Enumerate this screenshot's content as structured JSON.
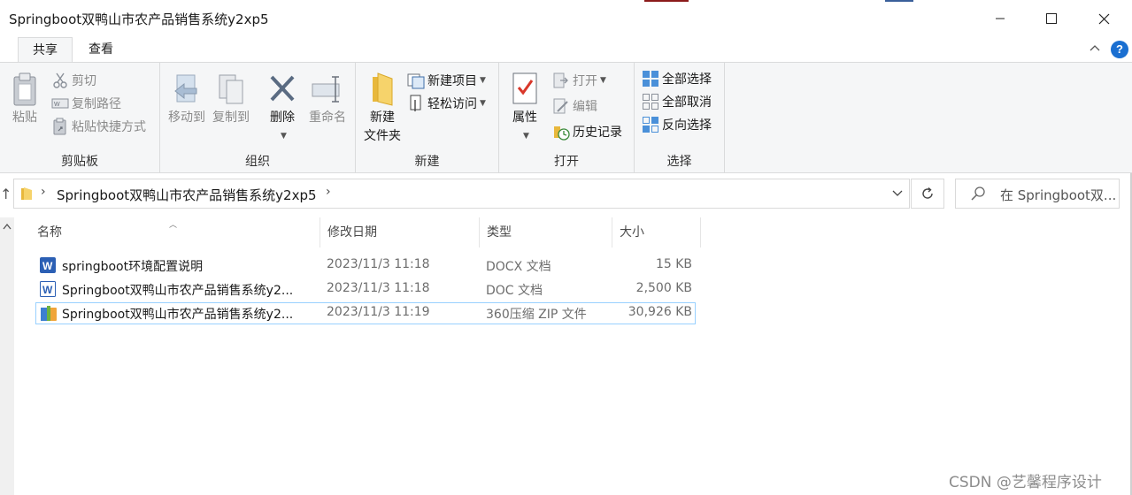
{
  "window": {
    "title": "Springboot双鸭山市农产品销售系统y2xp5"
  },
  "tabs": [
    {
      "label": "共享"
    },
    {
      "label": "查看"
    }
  ],
  "ribbon": {
    "clipboard": {
      "paste": "粘贴",
      "cut": "剪切",
      "copy_path": "复制路径",
      "paste_shortcut": "粘贴快捷方式",
      "label": "剪贴板"
    },
    "organize": {
      "move_to": "移动到",
      "copy_to": "复制到",
      "delete": "删除",
      "rename": "重命名",
      "label": "组织"
    },
    "new": {
      "new_folder_line1": "新建",
      "new_folder_line2": "文件夹",
      "new_item": "新建项目",
      "easy_access": "轻松访问",
      "label": "新建"
    },
    "open": {
      "properties": "属性",
      "open": "打开",
      "edit": "编辑",
      "history": "历史记录",
      "label": "打开"
    },
    "select": {
      "select_all": "全部选择",
      "select_none": "全部取消",
      "invert": "反向选择",
      "label": "选择"
    }
  },
  "address": {
    "path": "Springboot双鸭山市农产品销售系统y2xp5",
    "search_placeholder": "在 Springboot双..."
  },
  "columns": {
    "name": "名称",
    "modified": "修改日期",
    "type": "类型",
    "size": "大小"
  },
  "files": [
    {
      "name": "springboot环境配置说明",
      "modified": "2023/11/3 11:18",
      "type": "DOCX 文档",
      "size": "15 KB",
      "icon": "word-docx-icon"
    },
    {
      "name": "Springboot双鸭山市农产品销售系统y2...",
      "modified": "2023/11/3 11:18",
      "type": "DOC 文档",
      "size": "2,500 KB",
      "icon": "word-doc-icon"
    },
    {
      "name": "Springboot双鸭山市农产品销售系统y2...",
      "modified": "2023/11/3 11:19",
      "type": "360压缩 ZIP 文件",
      "size": "30,926 KB",
      "icon": "zip-archive-icon"
    }
  ],
  "watermark": "CSDN @艺馨程序设计",
  "colors": {
    "accent_blue": "#1a6fd1",
    "ribbon_bg": "#f5f6f7",
    "selection_border": "#99d1ff"
  }
}
